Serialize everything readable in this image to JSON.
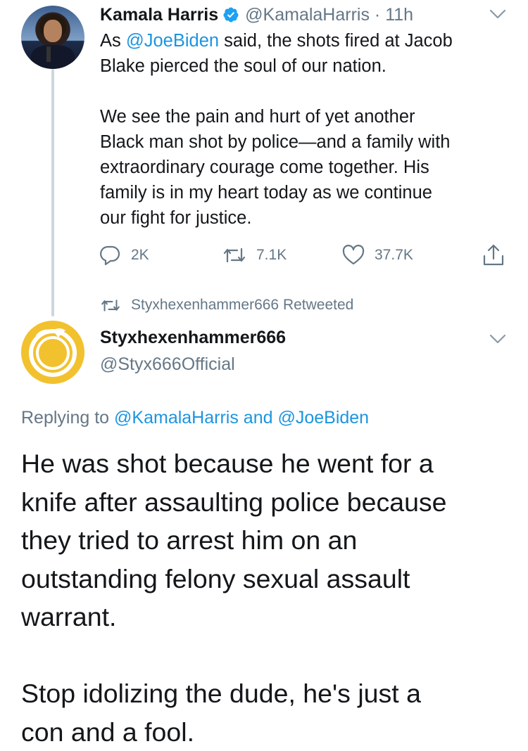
{
  "original_tweet": {
    "name": "Kamala Harris",
    "handle": "@KamalaHarris",
    "separator": " · ",
    "time": "11h",
    "text": {
      "prefix": "As ",
      "mention": "@JoeBiden",
      "line1_rest": " said, the shots fired at Jacob",
      "line2": "Blake pierced the soul of our nation.",
      "para2": [
        "We see the pain and hurt of yet another",
        "Black man shot by police—and a family with",
        "extraordinary courage come together. His",
        "family is in my heart today as we continue",
        "our fight for justice."
      ]
    },
    "actions": {
      "replies": "2K",
      "retweets": "7.1K",
      "likes": "37.7K"
    }
  },
  "retweet_notice": "Styxhexenhammer666 Retweeted",
  "reply_tweet": {
    "name": "Styxhexenhammer666",
    "handle": "@Styx666Official",
    "replying_label": "Replying to ",
    "replying_mention1": "@KamalaHarris",
    "replying_and": " and ",
    "replying_mention2": "@JoeBiden",
    "text_para1": [
      "He was shot because he went for a",
      "knife after assaulting police because",
      "they tried to arrest him on an",
      "outstanding felony sexual assault",
      "warrant."
    ],
    "text_para2": [
      "Stop idolizing the dude, he's just a",
      "con and a fool."
    ]
  },
  "colors": {
    "link": "#1b95e0",
    "secondary_text": "#657786",
    "verified": "#1da1f2",
    "avatar2_bg": "#f2c12e"
  },
  "icons": [
    "verified-badge-icon",
    "chevron-down-icon",
    "reply-icon",
    "retweet-icon",
    "like-icon",
    "share-icon"
  ]
}
